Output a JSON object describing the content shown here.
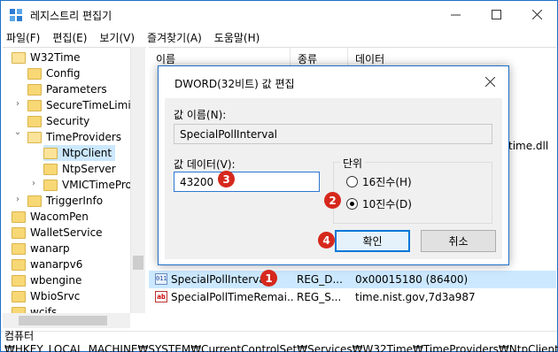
{
  "window": {
    "title": "레지스트리 편집기",
    "minimize_icon": "minimize-icon",
    "maximize_icon": "maximize-icon",
    "close_icon": "close-icon"
  },
  "menu": [
    "파일(F)",
    "편집(E)",
    "보기(V)",
    "즐겨찾기(A)",
    "도움말(H)"
  ],
  "tree": {
    "items": [
      {
        "label": "W32Time",
        "expander": ""
      },
      {
        "label": "Config",
        "expander": ""
      },
      {
        "label": "Parameters",
        "expander": ""
      },
      {
        "label": "SecureTimeLimits",
        "expander": "›"
      },
      {
        "label": "Security",
        "expander": ""
      },
      {
        "label": "TimeProviders",
        "expander": "⌄"
      },
      {
        "label": "NtpClient",
        "expander": ""
      },
      {
        "label": "NtpServer",
        "expander": ""
      },
      {
        "label": "VMICTimeProv",
        "expander": "›"
      },
      {
        "label": "TriggerInfo",
        "expander": "›"
      },
      {
        "label": "WacomPen",
        "expander": ""
      },
      {
        "label": "WalletService",
        "expander": ""
      },
      {
        "label": "wanarp",
        "expander": ""
      },
      {
        "label": "wanarpv6",
        "expander": ""
      },
      {
        "label": "wbengine",
        "expander": ""
      },
      {
        "label": "WbioSrvc",
        "expander": ""
      },
      {
        "label": "wcifs",
        "expander": ""
      }
    ]
  },
  "list": {
    "headers": [
      "이름",
      "종류",
      "데이터"
    ],
    "partial_visible_data": "time.dll",
    "rows": [
      {
        "icon": "dword-value-icon",
        "name": "SpecialPollInterval",
        "type": "REG_D...",
        "data": "0x00015180 (86400)",
        "selected": true
      },
      {
        "icon": "string-value-icon",
        "name": "SpecialPollTimeRemai...",
        "type": "REG_S...",
        "data": "time.nist.gov,7d3a987",
        "selected": false
      }
    ]
  },
  "status_path": "컴퓨터₩HKEY_LOCAL_MACHINE₩SYSTEM₩CurrentControlSet₩Services₩W32Time₩TimeProviders₩NtpClient",
  "dialog": {
    "title": "DWORD(32비트) 값 편집",
    "value_name_label": "값 이름(N):",
    "value_name": "SpecialPollInterval",
    "value_data_label": "값 데이터(V):",
    "value_data": "43200",
    "base_label": "단위",
    "radio_hex": "16진수(H)",
    "radio_dec": "10진수(D)",
    "selected_base": "10진수(D)",
    "ok_label": "확인",
    "cancel_label": "취소"
  },
  "annotations": [
    "1",
    "2",
    "3",
    "4"
  ],
  "colors": {
    "accent": "#0078d7",
    "badge": "#d6281c",
    "selection": "#cce8ff"
  }
}
